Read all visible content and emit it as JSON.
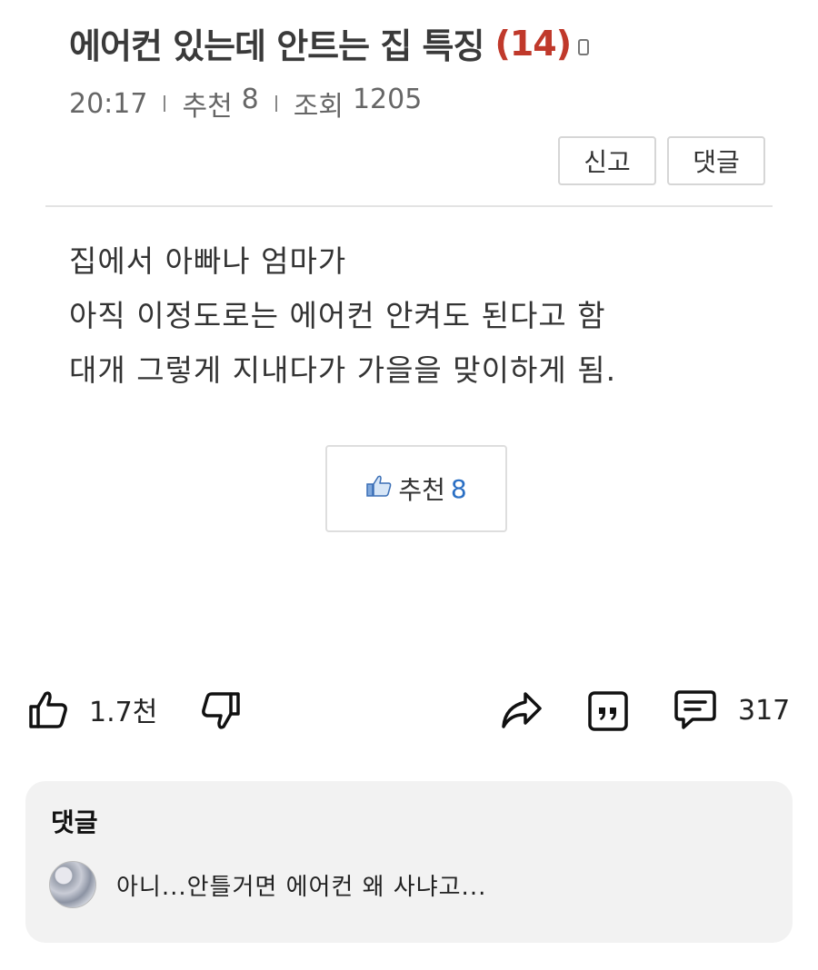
{
  "post": {
    "title": "에어컨 있는데 안트는 집 특징",
    "comment_count": "(14)",
    "time": "20:17",
    "recommend_label": "추천",
    "recommend_count": "8",
    "views_label": "조회",
    "views_count": "1205"
  },
  "buttons": {
    "report": "신고",
    "comment": "댓글"
  },
  "body": {
    "lines": [
      "집에서 아빠나 엄마가",
      "아직 이정도로는 에어컨 안켜도 된다고 함",
      "대개 그렇게 지내다가 가을을 맞이하게 됨."
    ]
  },
  "recommend_button": {
    "label": "추천",
    "count": "8"
  },
  "action_bar": {
    "likes": "1.7천",
    "comments": "317"
  },
  "comments_section": {
    "title": "댓글",
    "first_comment": "아니...안틀거면 에어컨 왜 사냐고..."
  },
  "colors": {
    "title_count": "#c0392b",
    "recommend_number": "#2a6fc4",
    "card_background": "#f2f2f2"
  }
}
